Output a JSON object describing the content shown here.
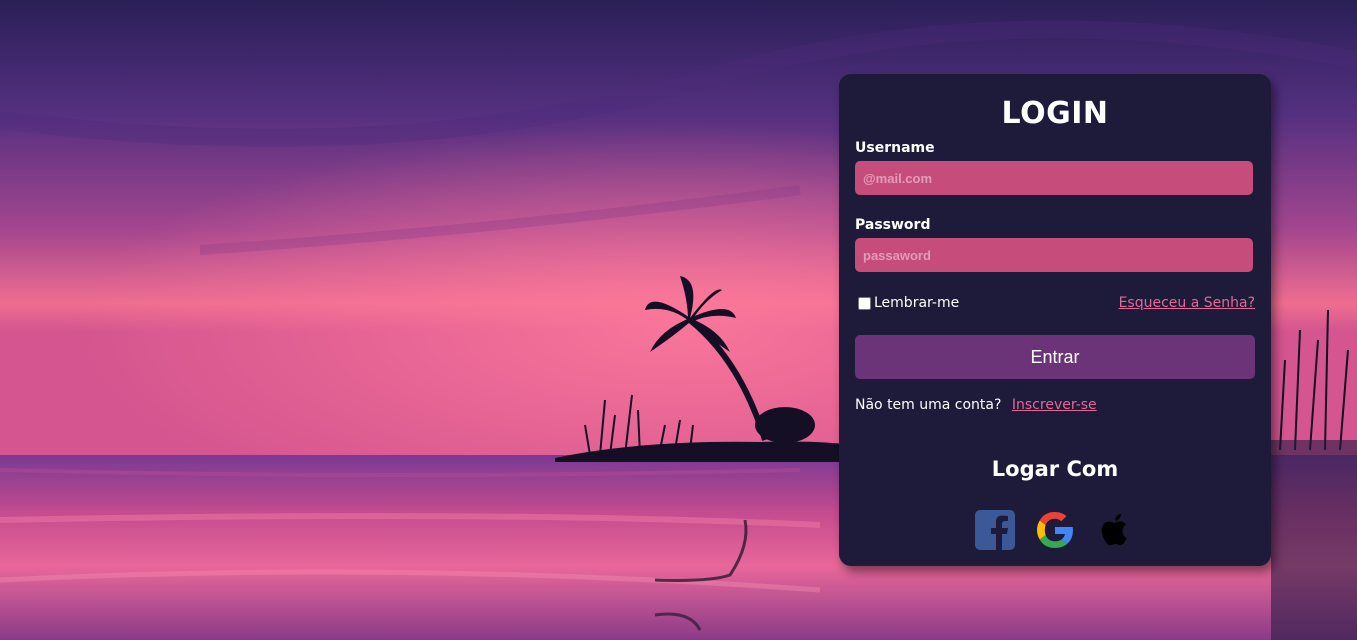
{
  "login": {
    "title": "LOGIN",
    "username_label": "Username",
    "username_placeholder": "@mail.com",
    "password_label": "Password",
    "password_placeholder": "passaword",
    "remember_label": "Lembrar-me",
    "forgot_link": "Esqueceu a Senha?",
    "submit_label": "Entrar",
    "no_account_text": "Não tem uma conta?",
    "signup_link": "Inscrever-se",
    "social_title": "Logar Com",
    "social_icons": [
      "facebook-icon",
      "google-icon",
      "apple-icon"
    ]
  },
  "colors": {
    "card_bg": "#1e1a3a",
    "input_bg": "#c64c7b",
    "button_bg": "#6b3378",
    "link": "#e2689a"
  }
}
